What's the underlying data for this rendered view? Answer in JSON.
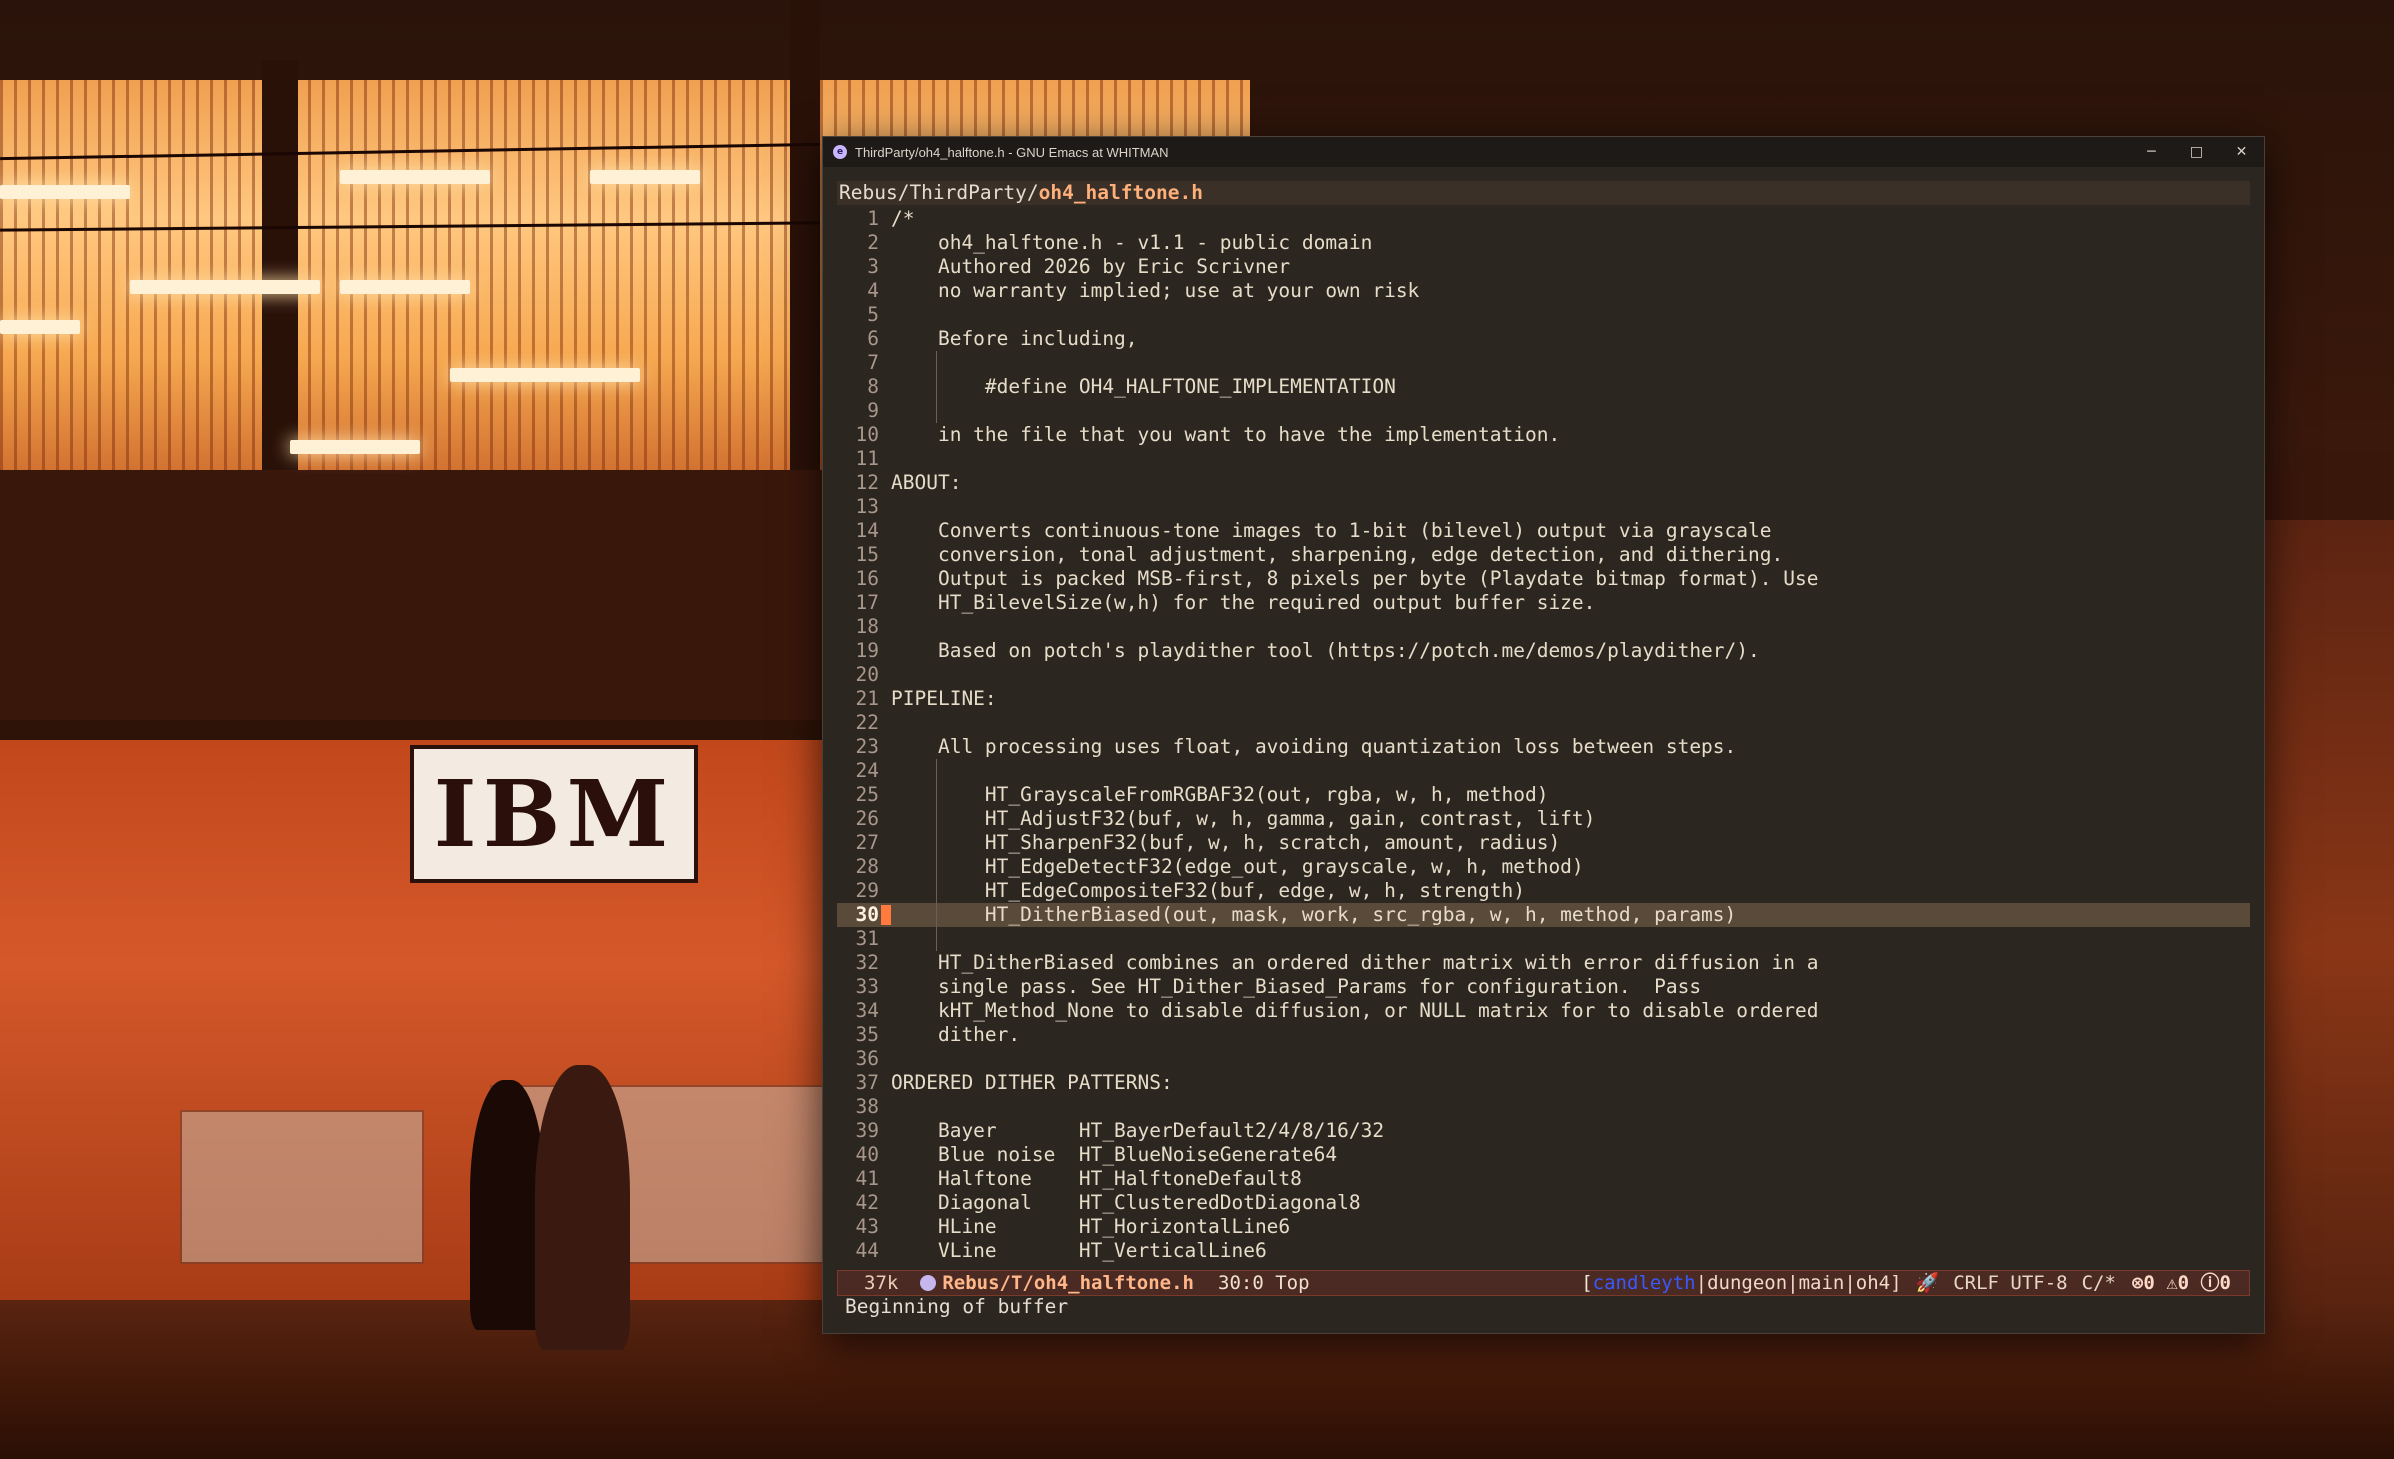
{
  "window": {
    "title": "ThirdParty/oh4_halftone.h - GNU Emacs at WHITMAN",
    "app_icon_glyph": "e",
    "controls": {
      "minimize": "─",
      "maximize": "□",
      "close": "✕"
    }
  },
  "header": {
    "path_prefix": "Rebus/ThirdParty/",
    "filename": "oh4_halftone.h"
  },
  "code": [
    {
      "n": "1",
      "t": "/*"
    },
    {
      "n": "2",
      "t": "    oh4_halftone.h - v1.1 - public domain"
    },
    {
      "n": "3",
      "t": "    Authored 2026 by Eric Scrivner"
    },
    {
      "n": "4",
      "t": "    no warranty implied; use at your own risk"
    },
    {
      "n": "5",
      "t": ""
    },
    {
      "n": "6",
      "t": "    Before including,"
    },
    {
      "n": "7",
      "t": ""
    },
    {
      "n": "8",
      "t": "        #define OH4_HALFTONE_IMPLEMENTATION"
    },
    {
      "n": "9",
      "t": ""
    },
    {
      "n": "10",
      "t": "    in the file that you want to have the implementation."
    },
    {
      "n": "11",
      "t": ""
    },
    {
      "n": "12",
      "t": "ABOUT:"
    },
    {
      "n": "13",
      "t": ""
    },
    {
      "n": "14",
      "t": "    Converts continuous-tone images to 1-bit (bilevel) output via grayscale"
    },
    {
      "n": "15",
      "t": "    conversion, tonal adjustment, sharpening, edge detection, and dithering."
    },
    {
      "n": "16",
      "t": "    Output is packed MSB-first, 8 pixels per byte (Playdate bitmap format). Use"
    },
    {
      "n": "17",
      "t": "    HT_BilevelSize(w,h) for the required output buffer size."
    },
    {
      "n": "18",
      "t": ""
    },
    {
      "n": "19",
      "t": "    Based on potch's playdither tool (https://potch.me/demos/playdither/)."
    },
    {
      "n": "20",
      "t": ""
    },
    {
      "n": "21",
      "t": "PIPELINE:"
    },
    {
      "n": "22",
      "t": ""
    },
    {
      "n": "23",
      "t": "    All processing uses float, avoiding quantization loss between steps."
    },
    {
      "n": "24",
      "t": ""
    },
    {
      "n": "25",
      "t": "        HT_GrayscaleFromRGBAF32(out, rgba, w, h, method)"
    },
    {
      "n": "26",
      "t": "        HT_AdjustF32(buf, w, h, gamma, gain, contrast, lift)"
    },
    {
      "n": "27",
      "t": "        HT_SharpenF32(buf, w, h, scratch, amount, radius)"
    },
    {
      "n": "28",
      "t": "        HT_EdgeDetectF32(edge_out, grayscale, w, h, method)"
    },
    {
      "n": "29",
      "t": "        HT_EdgeCompositeF32(buf, edge, w, h, strength)"
    },
    {
      "n": "30",
      "t": "        HT_DitherBiased(out, mask, work, src_rgba, w, h, method, params)"
    },
    {
      "n": "31",
      "t": ""
    },
    {
      "n": "32",
      "t": "    HT_DitherBiased combines an ordered dither matrix with error diffusion in a"
    },
    {
      "n": "33",
      "t": "    single pass. See HT_Dither_Biased_Params for configuration.  Pass"
    },
    {
      "n": "34",
      "t": "    kHT_Method_None to disable diffusion, or NULL matrix for to disable ordered"
    },
    {
      "n": "35",
      "t": "    dither."
    },
    {
      "n": "36",
      "t": ""
    },
    {
      "n": "37",
      "t": "ORDERED DITHER PATTERNS:"
    },
    {
      "n": "38",
      "t": ""
    },
    {
      "n": "39",
      "t": "    Bayer       HT_BayerDefault2/4/8/16/32"
    },
    {
      "n": "40",
      "t": "    Blue noise  HT_BlueNoiseGenerate64"
    },
    {
      "n": "41",
      "t": "    Halftone    HT_HalftoneDefault8"
    },
    {
      "n": "42",
      "t": "    Diagonal    HT_ClusteredDotDiagonal8"
    },
    {
      "n": "43",
      "t": "    HLine       HT_HorizontalLine6"
    },
    {
      "n": "44",
      "t": "    VLine       HT_VerticalLine6"
    }
  ],
  "current_line": "30",
  "modeline": {
    "size": "37k",
    "buffer": "Rebus/T/oh4_halftone.h",
    "position": "30:0 Top",
    "bracket_open": "[",
    "user": "candleyth",
    "branch": "|dungeon|main|oh4]",
    "rocket": "🚀",
    "encoding": "CRLF UTF-8",
    "mode_icon": "C/*",
    "diagnostics": "⊗0 ⚠0 ⓘ0"
  },
  "echo_area": "Beginning of buffer",
  "wallpaper": {
    "sign": "IBM"
  }
}
